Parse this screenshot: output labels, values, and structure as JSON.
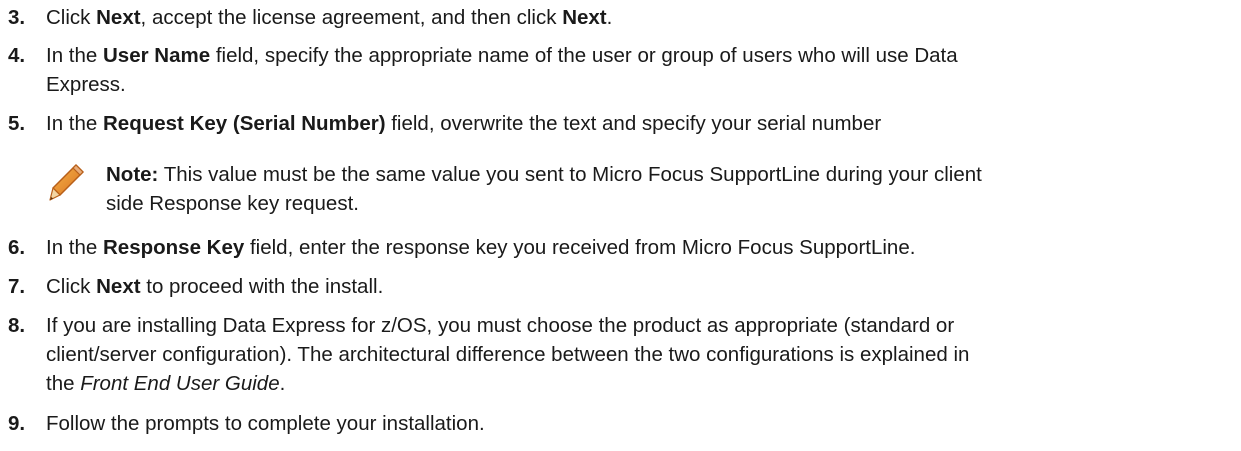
{
  "steps": [
    {
      "number": "3.",
      "parts": [
        {
          "t": "Click "
        },
        {
          "b": "Next"
        },
        {
          "t": ", accept the license agreement, and then click "
        },
        {
          "b": "Next"
        },
        {
          "t": "."
        }
      ]
    },
    {
      "number": "4.",
      "parts": [
        {
          "t": "In the "
        },
        {
          "b": "User Name"
        },
        {
          "t": " field, specify the appropriate name of the user or group of users who will use Data"
        }
      ],
      "cont": [
        {
          "t": "Express."
        }
      ]
    },
    {
      "number": "5.",
      "parts": [
        {
          "t": "In the "
        },
        {
          "b": "Request Key (Serial Number)"
        },
        {
          "t": " field, overwrite the text and specify your serial number"
        }
      ]
    },
    {
      "number": "6.",
      "parts": [
        {
          "t": "In the "
        },
        {
          "b": "Response Key"
        },
        {
          "t": " field, enter the response key you received from Micro Focus SupportLine."
        }
      ]
    },
    {
      "number": "7.",
      "parts": [
        {
          "t": "Click "
        },
        {
          "b": "Next"
        },
        {
          "t": " to proceed with the install."
        }
      ]
    },
    {
      "number": "8.",
      "parts": [
        {
          "t": "If you are installing Data Express for z/OS, you must choose the product as appropriate (standard or"
        }
      ],
      "cont": [
        {
          "t": "client/server configuration). The architectural difference between the two configurations is explained in"
        }
      ],
      "cont2": [
        {
          "t": "the "
        },
        {
          "i": "Front End User Guide"
        },
        {
          "t": "."
        }
      ]
    },
    {
      "number": "9.",
      "parts": [
        {
          "t": "Follow the prompts to complete your installation."
        }
      ]
    }
  ],
  "note": {
    "icon": "pencil-icon",
    "label": "Note:",
    "line1": " This value must be the same value you sent to Micro Focus SupportLine during your client",
    "line2": "side Response key request."
  }
}
